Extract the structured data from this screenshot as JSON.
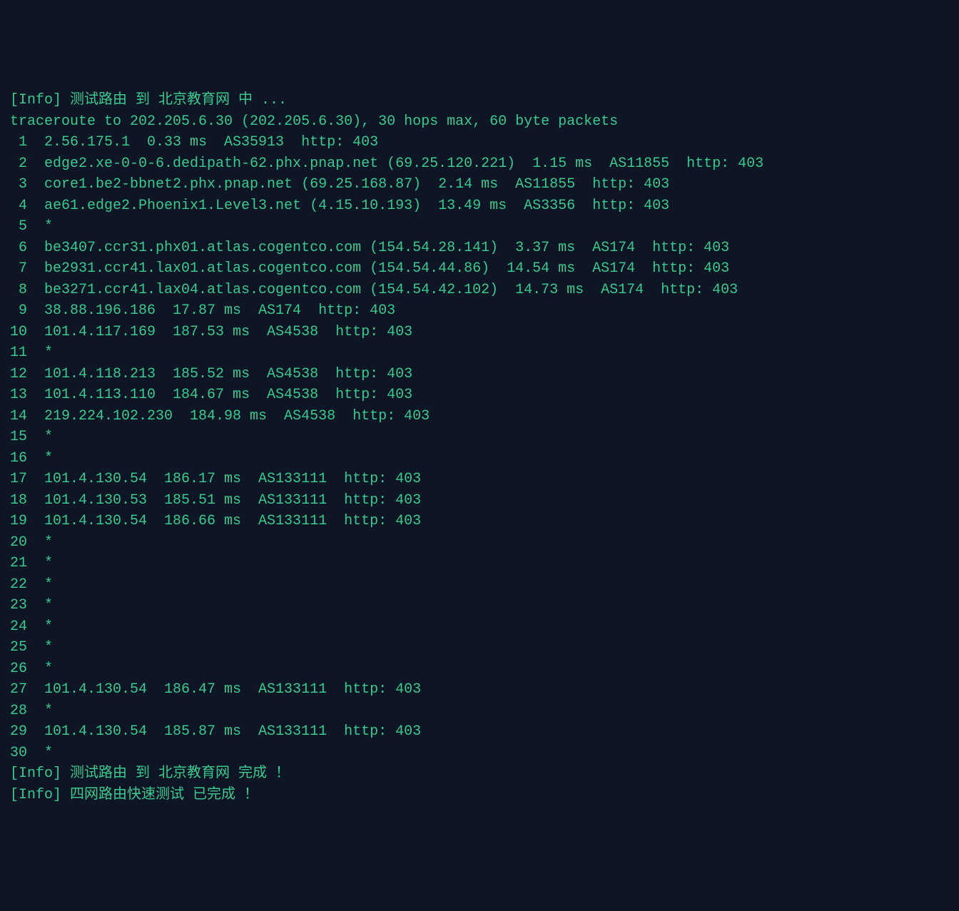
{
  "info_start": "[Info] 测试路由 到 北京教育网 中 ...",
  "header": "traceroute to 202.205.6.30 (202.205.6.30), 30 hops max, 60 byte packets",
  "hops": [
    {
      "n": 1,
      "text": "2.56.175.1  0.33 ms  AS35913  http: 403"
    },
    {
      "n": 2,
      "text": "edge2.xe-0-0-6.dedipath-62.phx.pnap.net (69.25.120.221)  1.15 ms  AS11855  http: 403"
    },
    {
      "n": 3,
      "text": "core1.be2-bbnet2.phx.pnap.net (69.25.168.87)  2.14 ms  AS11855  http: 403"
    },
    {
      "n": 4,
      "text": "ae61.edge2.Phoenix1.Level3.net (4.15.10.193)  13.49 ms  AS3356  http: 403"
    },
    {
      "n": 5,
      "text": "*"
    },
    {
      "n": 6,
      "text": "be3407.ccr31.phx01.atlas.cogentco.com (154.54.28.141)  3.37 ms  AS174  http: 403"
    },
    {
      "n": 7,
      "text": "be2931.ccr41.lax01.atlas.cogentco.com (154.54.44.86)  14.54 ms  AS174  http: 403"
    },
    {
      "n": 8,
      "text": "be3271.ccr41.lax04.atlas.cogentco.com (154.54.42.102)  14.73 ms  AS174  http: 403"
    },
    {
      "n": 9,
      "text": "38.88.196.186  17.87 ms  AS174  http: 403"
    },
    {
      "n": 10,
      "text": "101.4.117.169  187.53 ms  AS4538  http: 403"
    },
    {
      "n": 11,
      "text": "*"
    },
    {
      "n": 12,
      "text": "101.4.118.213  185.52 ms  AS4538  http: 403"
    },
    {
      "n": 13,
      "text": "101.4.113.110  184.67 ms  AS4538  http: 403"
    },
    {
      "n": 14,
      "text": "219.224.102.230  184.98 ms  AS4538  http: 403"
    },
    {
      "n": 15,
      "text": "*"
    },
    {
      "n": 16,
      "text": "*"
    },
    {
      "n": 17,
      "text": "101.4.130.54  186.17 ms  AS133111  http: 403"
    },
    {
      "n": 18,
      "text": "101.4.130.53  185.51 ms  AS133111  http: 403"
    },
    {
      "n": 19,
      "text": "101.4.130.54  186.66 ms  AS133111  http: 403"
    },
    {
      "n": 20,
      "text": "*"
    },
    {
      "n": 21,
      "text": "*"
    },
    {
      "n": 22,
      "text": "*"
    },
    {
      "n": 23,
      "text": "*"
    },
    {
      "n": 24,
      "text": "*"
    },
    {
      "n": 25,
      "text": "*"
    },
    {
      "n": 26,
      "text": "*"
    },
    {
      "n": 27,
      "text": "101.4.130.54  186.47 ms  AS133111  http: 403"
    },
    {
      "n": 28,
      "text": "*"
    },
    {
      "n": 29,
      "text": "101.4.130.54  185.87 ms  AS133111  http: 403"
    },
    {
      "n": 30,
      "text": "*"
    }
  ],
  "info_done1": "[Info] 测试路由 到 北京教育网 完成 ！",
  "info_done2": "[Info] 四网路由快速测试 已完成 ！"
}
